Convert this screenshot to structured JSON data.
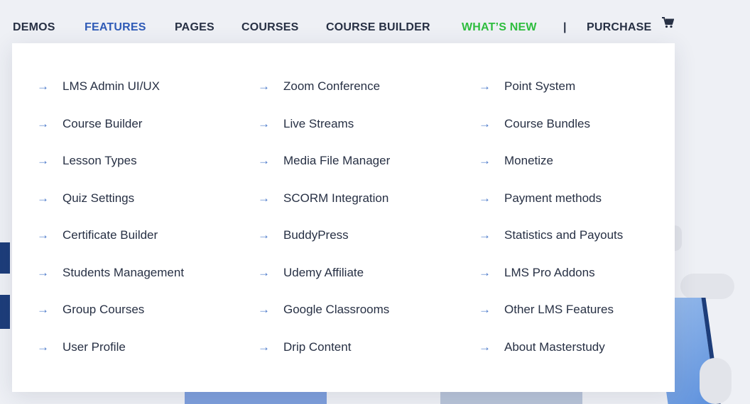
{
  "nav": {
    "items": [
      "DEMOS",
      "FEATURES",
      "PAGES",
      "COURSES",
      "COURSE BUILDER",
      "WHAT’S NEW"
    ],
    "separator": "|",
    "purchase": "PURCHASE",
    "active_color": "#2f5bb7",
    "new_color": "#2ebd3e"
  },
  "features_menu": {
    "columns": [
      [
        "LMS Admin UI/UX",
        "Course Builder",
        "Lesson Types",
        "Quiz Settings",
        "Certificate Builder",
        "Students Management",
        "Group Courses",
        "User Profile"
      ],
      [
        "Zoom Conference",
        "Live Streams",
        "Media File Manager",
        "SCORM Integration",
        "BuddyPress",
        "Udemy Affiliate",
        "Google Classrooms",
        "Drip Content"
      ],
      [
        "Point System",
        "Course Bundles",
        "Monetize",
        "Payment methods",
        "Statistics and Payouts",
        "LMS Pro Addons",
        "Other LMS Features",
        "About Masterstudy"
      ]
    ]
  }
}
